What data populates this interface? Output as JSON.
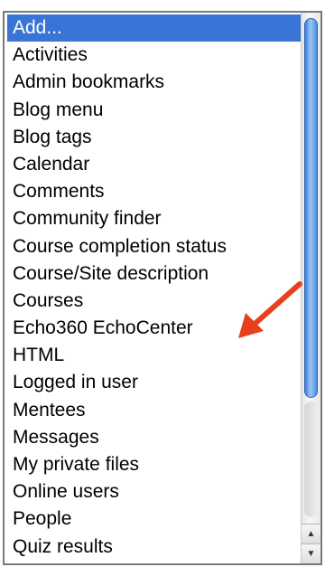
{
  "listbox": {
    "items": [
      {
        "label": "Add...",
        "selected": true
      },
      {
        "label": "Activities",
        "selected": false
      },
      {
        "label": "Admin bookmarks",
        "selected": false
      },
      {
        "label": "Blog menu",
        "selected": false
      },
      {
        "label": "Blog tags",
        "selected": false
      },
      {
        "label": "Calendar",
        "selected": false
      },
      {
        "label": "Comments",
        "selected": false
      },
      {
        "label": "Community finder",
        "selected": false
      },
      {
        "label": "Course completion status",
        "selected": false
      },
      {
        "label": "Course/Site description",
        "selected": false
      },
      {
        "label": "Courses",
        "selected": false
      },
      {
        "label": "Echo360 EchoCenter",
        "selected": false
      },
      {
        "label": "HTML",
        "selected": false
      },
      {
        "label": "Logged in user",
        "selected": false
      },
      {
        "label": "Mentees",
        "selected": false
      },
      {
        "label": "Messages",
        "selected": false
      },
      {
        "label": "My private files",
        "selected": false
      },
      {
        "label": "Online users",
        "selected": false
      },
      {
        "label": "People",
        "selected": false
      },
      {
        "label": "Quiz results",
        "selected": false
      }
    ],
    "highlighted_item": "Echo360 EchoCenter"
  },
  "scrollbar": {
    "up_icon": "triangle-up-icon",
    "down_icon": "triangle-down-icon",
    "up_glyph": "▲",
    "down_glyph": "▼"
  },
  "annotation": {
    "icon": "red-arrow-icon",
    "color": "#e8401c"
  },
  "colors": {
    "selection": "#3875d7",
    "scroll_thumb": "#4a8ee2"
  }
}
